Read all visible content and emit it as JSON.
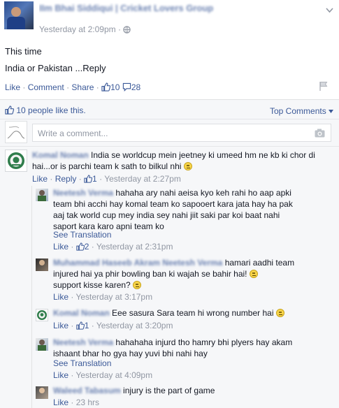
{
  "post": {
    "author_name": "IIm Bhai Siddiqui | Cricket Lovers Group",
    "timestamp": "Yesterday at 2:09pm",
    "text_line1": "This time",
    "text_line2": "India or Pakistan ...Reply",
    "actions": {
      "like": "Like",
      "comment": "Comment",
      "share": "Share",
      "like_count": "10",
      "comment_count": "28"
    }
  },
  "summary": {
    "likes": "10 people like this.",
    "top_comments": "Top Comments"
  },
  "composer": {
    "placeholder": "Write a comment..."
  },
  "comments": [
    {
      "author": "Komal Noman",
      "text": "India se worldcup mein jeetney ki umeed hm ne kb ki chor di hai...or is parchi team k sath to bilkul nhi",
      "like": "Like",
      "reply": "Reply",
      "likes": "1",
      "time": "Yesterday at 2:27pm"
    },
    {
      "author": "Neetesh Verma",
      "text": "hahaha ary nahi aeisa kyo keh rahi ho aap apki team bhi acchi hay komal team ko sapooert kara jata hay ha pak aaj tak world cup mey india sey nahi jiit saki par koi baat nahi saport kara karo apni team ko",
      "see_translation": "See Translation",
      "like": "Like",
      "likes": "2",
      "time": "Yesterday at 2:31pm"
    },
    {
      "author": "Muhammad Haseeb Akram",
      "mention": "Neetesh Verma",
      "text": "hamari aadhi team injured hai ya phir bowling ban ki wajah se bahir hai!",
      "text2": "support kisse karen?",
      "like": "Like",
      "time": "Yesterday at 3:17pm"
    },
    {
      "author": "Komal Noman",
      "text": "Eee sasura Sara team hi wrong number hai",
      "like": "Like",
      "likes": "1",
      "time": "Yesterday at 3:20pm"
    },
    {
      "author": "Neetesh Verma",
      "text": "hahahaha injurd tho hamry bhi plyers hay akam ishaant bhar ho gya hay yuvi bhi nahi hay",
      "see_translation": "See Translation",
      "like": "Like",
      "time": "Yesterday at 4:09pm"
    },
    {
      "author": "Waleed Tabasum",
      "text": "injury is the part of game",
      "like": "Like",
      "time": "23 hrs"
    }
  ],
  "colors": {
    "link": "#3b5998",
    "muted": "#9197a3",
    "feedback_bg": "#f6f7f9",
    "border": "#e5e6e9"
  }
}
